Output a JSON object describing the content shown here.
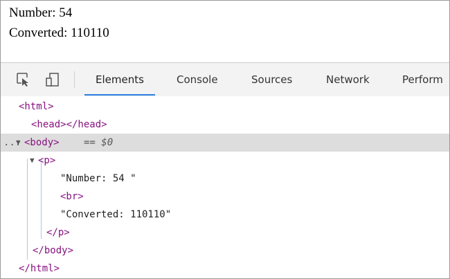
{
  "page": {
    "number_line": "Number: 54",
    "converted_line": "Converted: 110110"
  },
  "devtools": {
    "toolbar": {
      "icons": [
        "select-element-icon",
        "device-toolbar-icon"
      ],
      "tabs": [
        {
          "label": "Elements",
          "active": true
        },
        {
          "label": "Console",
          "active": false
        },
        {
          "label": "Sources",
          "active": false
        },
        {
          "label": "Network",
          "active": false
        },
        {
          "label": "Perform",
          "active": false
        }
      ],
      "accent_color": "#2a7de1"
    },
    "dom_tree": {
      "html_open": "<html>",
      "head": "<head></head>",
      "body_open": "<body>",
      "body_marker": "== $0",
      "dots": "...",
      "p_open": "<p>",
      "text1": "\"Number: 54 \"",
      "br": "<br>",
      "text2": "\"Converted: 110110\"",
      "p_close": "</p>",
      "body_close": "</body>",
      "html_close": "</html>"
    }
  }
}
